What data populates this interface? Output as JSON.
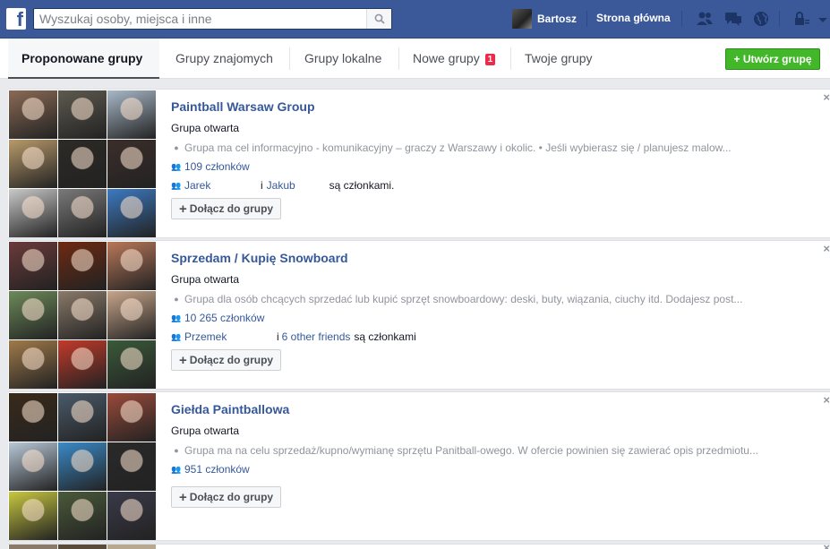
{
  "topbar": {
    "search_placeholder": "Wyszukaj osoby, miejsca i inne",
    "user_name": "Bartosz",
    "home_label": "Strona główna"
  },
  "tabs": [
    {
      "label": "Proponowane grupy"
    },
    {
      "label": "Grupy znajomych"
    },
    {
      "label": "Grupy lokalne"
    },
    {
      "label": "Nowe grupy",
      "badge": "1"
    },
    {
      "label": "Twoje grupy"
    }
  ],
  "create_button": "Utwórz grupę",
  "join_label": "Dołącz do grupy",
  "close_glyph": "×",
  "groups": [
    {
      "title": "Paintball Warsaw Group",
      "type": "Grupa otwarta",
      "description": "Grupa ma cel informacyjno - komunikacyjny – graczy z Warszawy i okolic. • Jeśli wybierasz się / planujesz malow...",
      "members": "109 członków",
      "friend1": "Jarek",
      "connector": "i",
      "friend2": "Jakub",
      "suffix": "są członkami.",
      "photo_colors": [
        "#8a6a55",
        "#5d5a4f",
        "#a8b8c8",
        "#b89a6a",
        "#2d2a26",
        "#3b2e2a",
        "#c9c9c9",
        "#7a7a7a",
        "#3c7ac2"
      ]
    },
    {
      "title": "Sprzedam / Kupię Snowboard",
      "type": "Grupa otwarta",
      "description": "Grupa dla osób chcących sprzedać lub kupić sprzęt snowboardowy: deski, buty, wiązania, ciuchy itd. Dodajesz post...",
      "members": "10 265 członków",
      "friend1": "Przemek",
      "connector": "i",
      "friend2": "6 other friends",
      "suffix": "są członkami",
      "photo_colors": [
        "#6b3a3a",
        "#6e2a12",
        "#b9785a",
        "#6d8a5a",
        "#8a7a6a",
        "#c7a58a",
        "#a07a4a",
        "#c23a2a",
        "#3a5a3a"
      ]
    },
    {
      "title": "Giełda Paintballowa",
      "type": "Grupa otwarta",
      "description": "Grupa ma na celu sprzedaż/kupno/wymianę sprzętu Panitball-owego. W ofercie powinien się zawierać opis przedmiotu...",
      "members": "951 członków",
      "photo_colors": [
        "#3a2a1a",
        "#4a5a6a",
        "#9a4a3a",
        "#b8c8d8",
        "#3a8ac8",
        "#2a2a2a",
        "#c8c840",
        "#4a5a3a",
        "#3a3a4a"
      ]
    }
  ]
}
